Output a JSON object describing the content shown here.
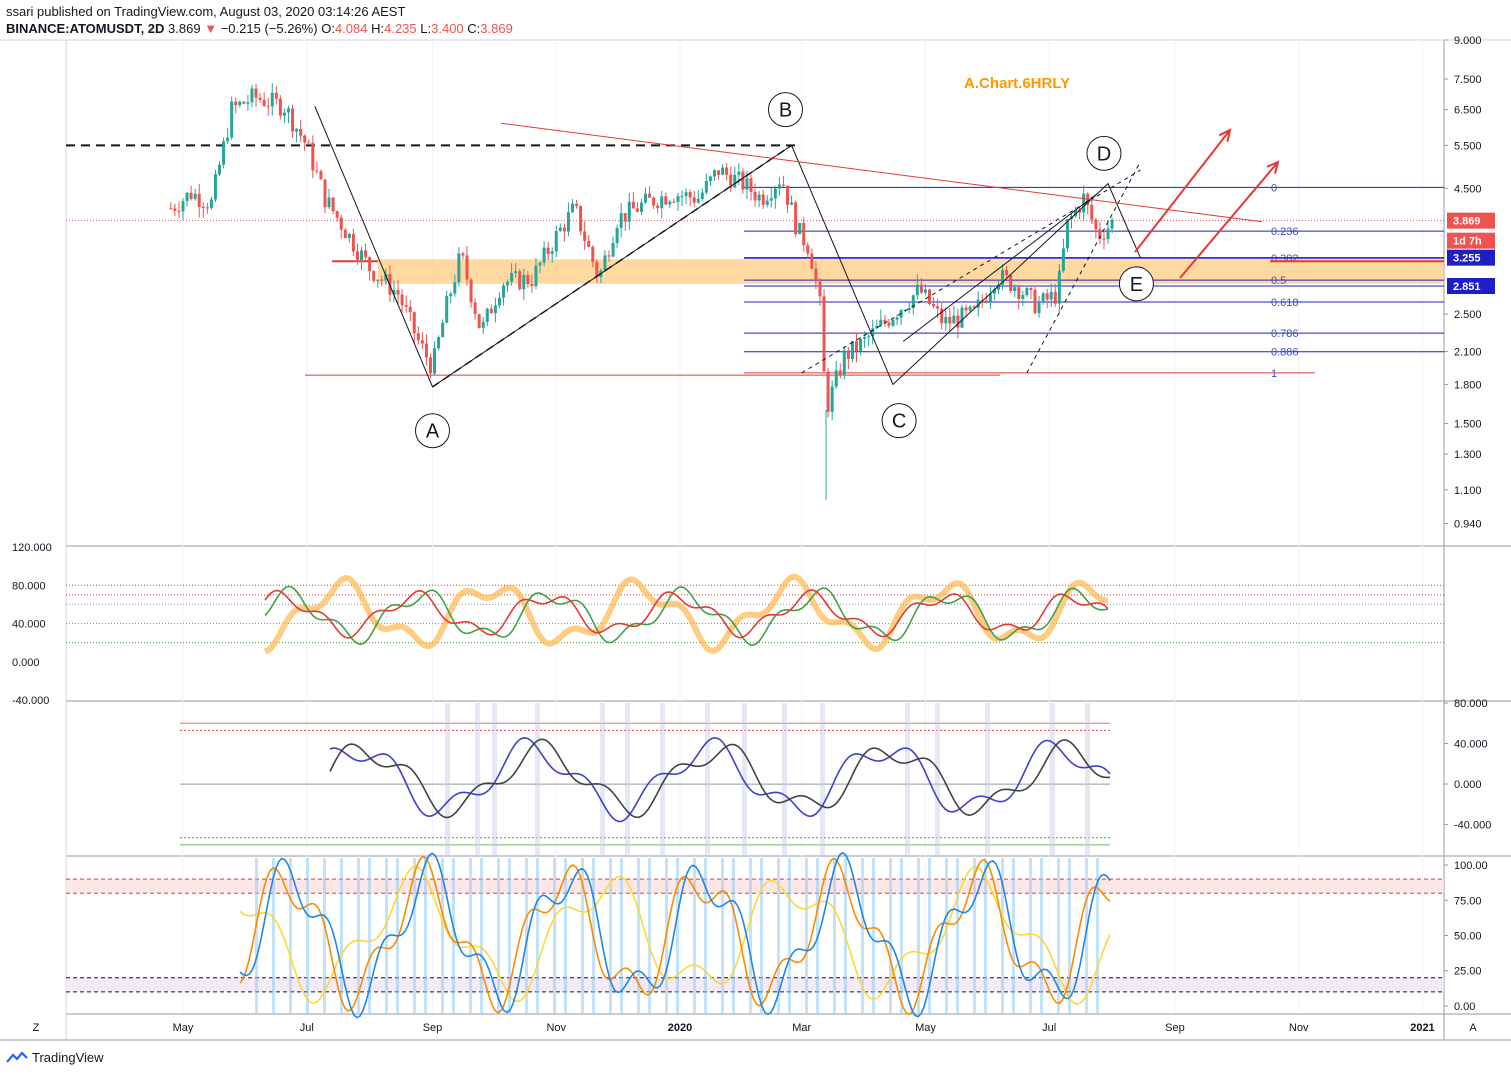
{
  "header": {
    "publisher": "ssari published on TradingView.com, August 03, 2020 03:14:26 AEST",
    "symbol": "BINANCE:ATOMUSDT, 2D",
    "last": "3.869",
    "arrow": "▼",
    "change": "−0.215 (−5.26%)",
    "o_label": "O:",
    "o": "4.084",
    "h_label": "H:",
    "h": "4.235",
    "l_label": "L:",
    "l": "3.400",
    "c_label": "C:",
    "c": "3.869"
  },
  "annotations": {
    "title": "A.Chart.6HRLY",
    "wave_labels": [
      "A",
      "B",
      "C",
      "D",
      "E"
    ],
    "fib_levels": [
      "0",
      "0.236",
      "0.382",
      "0.5",
      "0.618",
      "0.786",
      "0.886",
      "1"
    ],
    "price_tags": [
      {
        "text": "3.869",
        "color": "#ef5350"
      },
      {
        "text": "1d 7h",
        "color": "#ef5350"
      },
      {
        "text": "3.255",
        "color": "#1e1ec8"
      },
      {
        "text": "2.851",
        "color": "#1e1ec8"
      }
    ],
    "scale_buttons": [
      "Z",
      "A"
    ]
  },
  "chart_data": [
    {
      "type": "candlestick",
      "symbol": "BINANCE:ATOMUSDT",
      "timeframe": "2D",
      "yscale": "log",
      "ylim": [
        0.85,
        9.0
      ],
      "y_ticks": [
        "9.000",
        "7.500",
        "6.500",
        "5.500",
        "4.500",
        "3.869",
        "3.255",
        "2.851",
        "2.500",
        "2.100",
        "1.800",
        "1.500",
        "1.300",
        "1.100",
        "0.940"
      ],
      "x_ticks": [
        "May",
        "Jul",
        "Sep",
        "Nov",
        "2020",
        "Mar",
        "May",
        "Jul",
        "Sep",
        "Nov",
        "2021"
      ],
      "close_path": [
        {
          "date": "2019-04-25",
          "close": 4.1
        },
        {
          "date": "2019-05-05",
          "close": 4.4
        },
        {
          "date": "2019-05-15",
          "close": 4.2
        },
        {
          "date": "2019-05-25",
          "close": 6.5
        },
        {
          "date": "2019-06-05",
          "close": 6.9
        },
        {
          "date": "2019-06-20",
          "close": 6.6
        },
        {
          "date": "2019-07-01",
          "close": 5.5
        },
        {
          "date": "2019-07-10",
          "close": 4.3
        },
        {
          "date": "2019-07-20",
          "close": 3.7
        },
        {
          "date": "2019-08-01",
          "close": 3.1
        },
        {
          "date": "2019-08-15",
          "close": 2.75
        },
        {
          "date": "2019-08-25",
          "close": 2.2
        },
        {
          "date": "2019-09-01",
          "close": 1.95
        },
        {
          "date": "2019-09-08",
          "close": 2.6
        },
        {
          "date": "2019-09-15",
          "close": 3.3
        },
        {
          "date": "2019-09-25",
          "close": 2.3
        },
        {
          "date": "2019-10-05",
          "close": 2.9
        },
        {
          "date": "2019-10-20",
          "close": 2.95
        },
        {
          "date": "2019-11-01",
          "close": 3.6
        },
        {
          "date": "2019-11-10",
          "close": 4.1
        },
        {
          "date": "2019-11-22",
          "close": 2.95
        },
        {
          "date": "2019-12-01",
          "close": 3.9
        },
        {
          "date": "2019-12-15",
          "close": 4.2
        },
        {
          "date": "2019-12-28",
          "close": 4.4
        },
        {
          "date": "2020-01-10",
          "close": 4.3
        },
        {
          "date": "2020-01-20",
          "close": 4.9
        },
        {
          "date": "2020-02-01",
          "close": 4.6
        },
        {
          "date": "2020-02-10",
          "close": 4.3
        },
        {
          "date": "2020-02-20",
          "close": 4.75
        },
        {
          "date": "2020-02-28",
          "close": 3.7
        },
        {
          "date": "2020-03-05",
          "close": 3.4
        },
        {
          "date": "2020-03-10",
          "close": 2.6
        },
        {
          "date": "2020-03-13",
          "close": 1.6
        },
        {
          "date": "2020-03-22",
          "close": 2.05
        },
        {
          "date": "2020-04-01",
          "close": 2.2
        },
        {
          "date": "2020-04-15",
          "close": 2.5
        },
        {
          "date": "2020-04-28",
          "close": 2.8
        },
        {
          "date": "2020-05-10",
          "close": 2.4
        },
        {
          "date": "2020-05-25",
          "close": 2.5
        },
        {
          "date": "2020-06-05",
          "close": 3.0
        },
        {
          "date": "2020-06-15",
          "close": 2.85
        },
        {
          "date": "2020-06-25",
          "close": 2.6
        },
        {
          "date": "2020-07-05",
          "close": 2.75
        },
        {
          "date": "2020-07-10",
          "close": 3.8
        },
        {
          "date": "2020-07-18",
          "close": 4.3
        },
        {
          "date": "2020-07-25",
          "close": 3.6
        },
        {
          "date": "2020-08-02",
          "close": 3.869
        }
      ],
      "all_time_swing": {
        "high": 7.3,
        "low": 1.05
      }
    },
    {
      "type": "line",
      "panel": "oscillator-1",
      "ylim": [
        -40,
        120
      ],
      "y_ticks": [
        "120.000",
        "80.000",
        "40.000",
        "0.000",
        "-40.000"
      ]
    },
    {
      "type": "line",
      "panel": "oscillator-2",
      "ylim": [
        -70,
        80
      ],
      "y_ticks": [
        "80.000",
        "40.000",
        "0.000",
        "-40.000"
      ]
    },
    {
      "type": "line",
      "panel": "stochastic",
      "ylim": [
        -5,
        105
      ],
      "y_ticks": [
        "100.00",
        "75.00",
        "50.00",
        "25.00",
        "0.00"
      ],
      "bands": [
        [
          80,
          90
        ],
        [
          10,
          20
        ]
      ]
    }
  ],
  "footer": {
    "brand": "TradingView"
  }
}
